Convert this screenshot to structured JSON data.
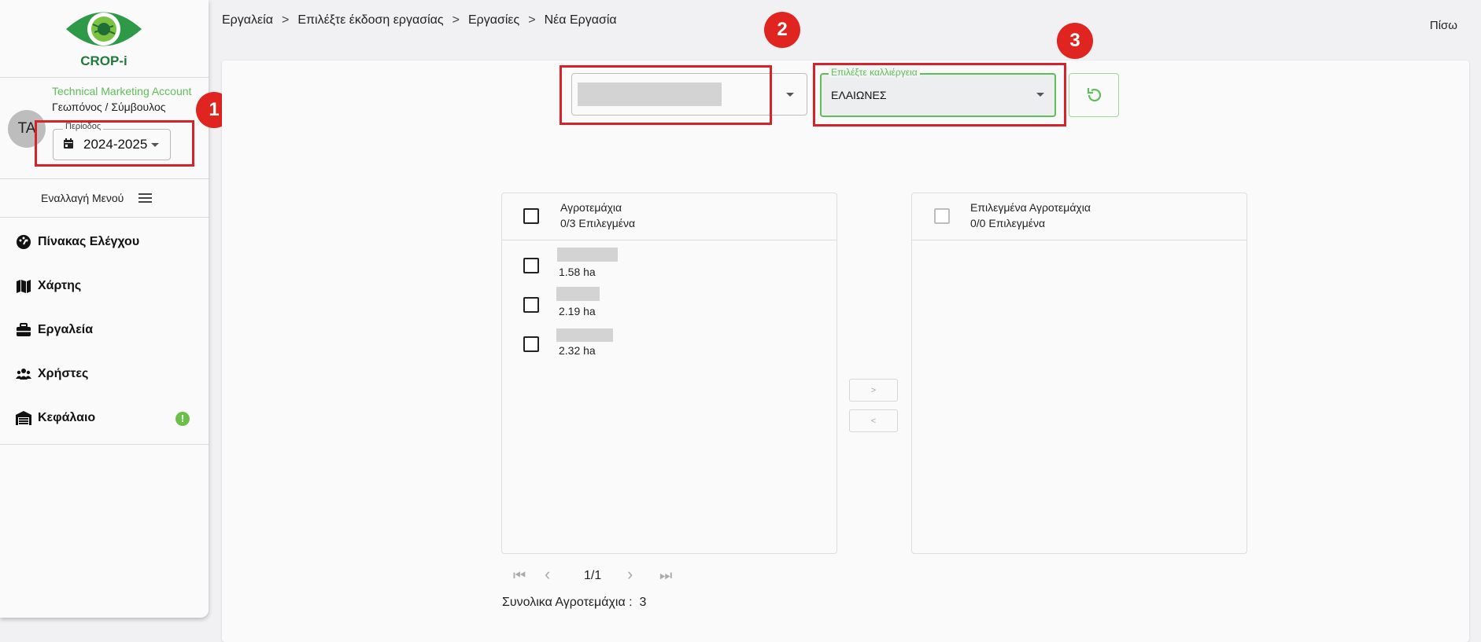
{
  "app": {
    "logo_text": "CROP-i",
    "brand_color": "#1f7a3c",
    "accent_color": "#5cbf57"
  },
  "sidebar": {
    "account_name": "Technical Marketing Account",
    "account_role": "Γεωπόνος / Σύμβουλος",
    "avatar_initials": "TA",
    "period": {
      "legend": "Περίοδος",
      "value": "2024-2025",
      "icon": "calendar-icon"
    },
    "menu_toggle_label": "Εναλλαγή Μενού",
    "items": [
      {
        "label": "Πίνακας Ελέγχου",
        "icon": "dashboard-icon"
      },
      {
        "label": "Χάρτης",
        "icon": "map-icon"
      },
      {
        "label": "Εργαλεία",
        "icon": "toolbox-icon"
      },
      {
        "label": "Χρήστες",
        "icon": "users-icon"
      },
      {
        "label": "Κεφάλαιο",
        "icon": "warehouse-icon",
        "alert_badge": "!"
      }
    ]
  },
  "header": {
    "breadcrumbs": [
      "Εργαλεία",
      "Επιλέξτε έκδοση εργασίας",
      "Εργασίες",
      "Νέα Εργασία"
    ],
    "separator": ">",
    "back_label": "Πίσω"
  },
  "filters": {
    "crop_legend": "Επιλέξτε καλλιέργεια",
    "crop_value": "ΕΛΑΙΩΝΕΣ"
  },
  "annotations": [
    "1",
    "2",
    "3"
  ],
  "left_list": {
    "title": "Αγροτεμάχια",
    "subtitle": "0/3 Επιλεγμένα",
    "items": [
      {
        "size": "1.58 ha"
      },
      {
        "size": "2.19 ha"
      },
      {
        "size": "2.32 ha"
      }
    ]
  },
  "right_list": {
    "title": "Επιλεγμένα Αγροτεμάχια",
    "subtitle": "0/0 Επιλεγμένα"
  },
  "transfer": {
    "move_right": ">",
    "move_left": "<"
  },
  "pagination": {
    "page": "1/1"
  },
  "total": {
    "label": "Συνολικα Αγροτεμάχια :",
    "value": "3"
  }
}
